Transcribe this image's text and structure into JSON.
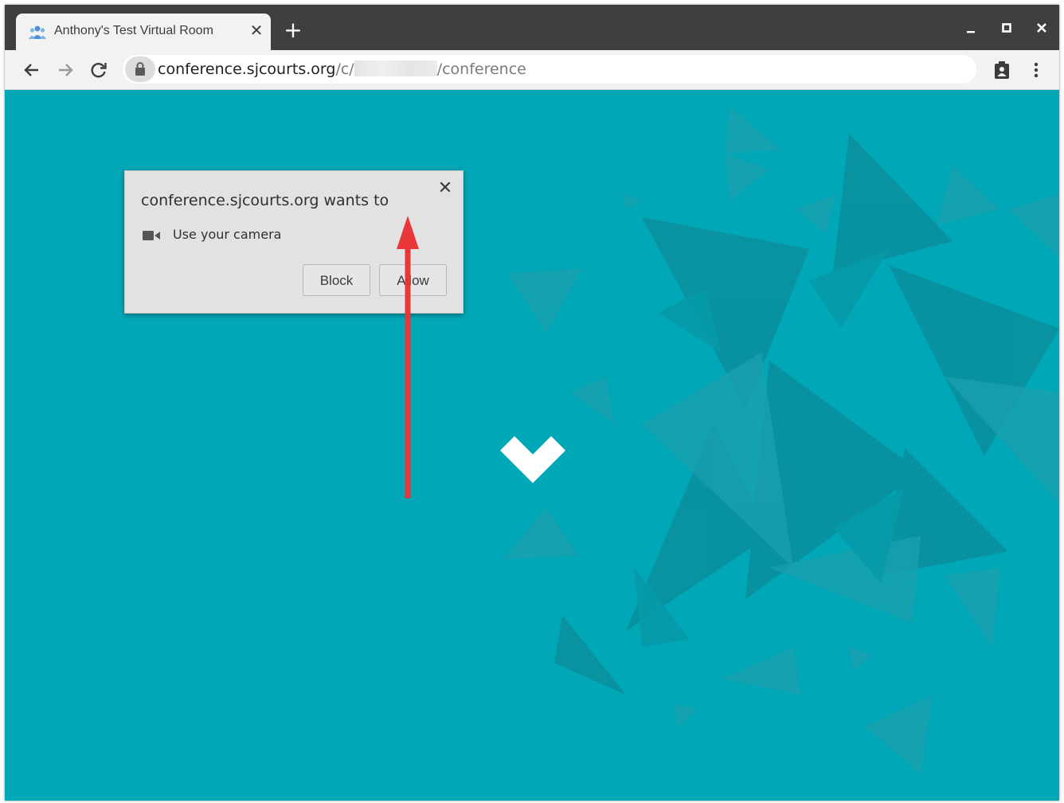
{
  "tab": {
    "title": "Anthony's Test Virtual Room",
    "close_label": "✕",
    "favicon": "people-group-icon"
  },
  "new_tab_label": "+",
  "window_controls": {
    "minimize": "–",
    "maximize": "▫",
    "close": "✕"
  },
  "toolbar": {
    "back_icon": "arrow-left-icon",
    "forward_icon": "arrow-right-icon",
    "reload_icon": "reload-icon",
    "site_info_icon": "lock-icon",
    "extension_icon": "clipboard-person-icon",
    "menu_icon": "kebab-menu-icon"
  },
  "address_bar": {
    "host": "conference.sjcourts.org",
    "path_prefix": "/c/",
    "path_suffix": "/conference"
  },
  "permission_popup": {
    "title": "conference.sjcourts.org wants to",
    "permission_text": "Use your camera",
    "permission_icon": "video-camera-icon",
    "close_label": "✕",
    "block_label": "Block",
    "allow_label": "Allow"
  },
  "colors": {
    "page_background": "#00a7b7",
    "annotation_arrow": "#e8363a",
    "tab_strip": "#3f3f3f"
  }
}
